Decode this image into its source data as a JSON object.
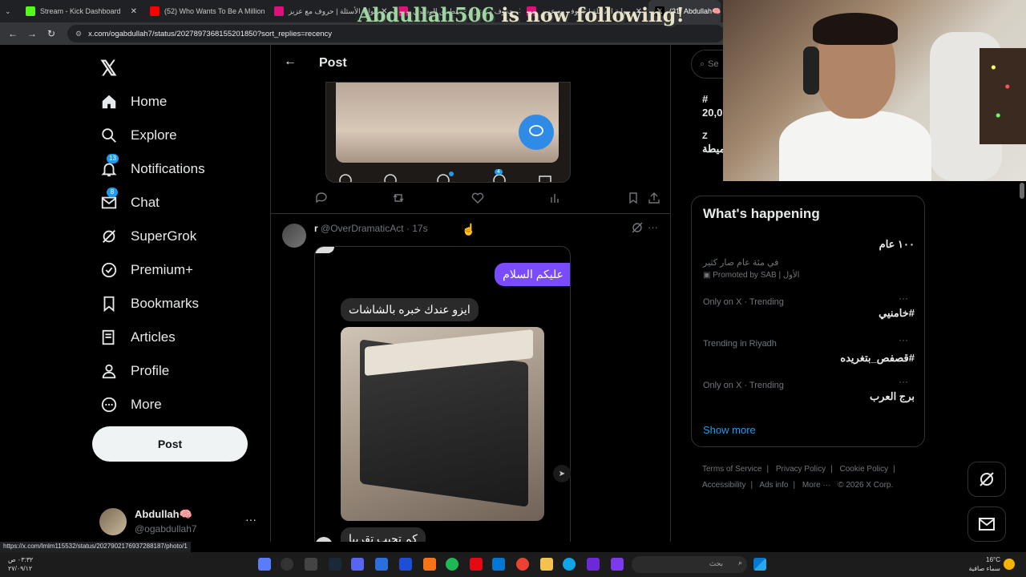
{
  "browser": {
    "tabs": [
      {
        "title": "Stream - Kick Dashboard",
        "color": "#53fc18"
      },
      {
        "title": "(52) Who Wants To Be A Million",
        "color": "#ff0000"
      },
      {
        "title": "بوابة الأسئلة | حروف مع عزيز",
        "color": "#e0107a"
      },
      {
        "title": "حروف مع عزيز - التطبيق الرسمي",
        "color": "#e0107a"
      },
      {
        "title": "بوابة الأسئلة | حروف مع عزيز",
        "color": "#e0107a"
      },
      {
        "title": "(21) Abdullah🧠",
        "color": "#ffffff"
      }
    ],
    "url": "x.com/ogabdullah7/status/2027897368155201850?sort_replies=recency",
    "status_url": "https://x.com/lmlm115532/status/2027902176937288187/photo/1"
  },
  "overlay": {
    "follow_name": "Abdullah506",
    "follow_text": " is now following!"
  },
  "nav": {
    "items": [
      {
        "label": "Home",
        "icon": "home-icon",
        "badge": ""
      },
      {
        "label": "Explore",
        "icon": "search-icon",
        "badge": ""
      },
      {
        "label": "Notifications",
        "icon": "bell-icon",
        "badge": "13"
      },
      {
        "label": "Chat",
        "icon": "mail-icon",
        "badge": "8"
      },
      {
        "label": "SuperGrok",
        "icon": "grok-icon",
        "badge": ""
      },
      {
        "label": "Premium+",
        "icon": "verified-icon",
        "badge": ""
      },
      {
        "label": "Bookmarks",
        "icon": "bookmark-icon",
        "badge": ""
      },
      {
        "label": "Articles",
        "icon": "article-icon",
        "badge": ""
      },
      {
        "label": "Profile",
        "icon": "person-icon",
        "badge": ""
      },
      {
        "label": "More",
        "icon": "more-circle-icon",
        "badge": ""
      }
    ],
    "post_button": "Post",
    "account": {
      "name": "Abdullah🧠",
      "handle": "@ogabdullah7",
      "more": "···"
    }
  },
  "main": {
    "title": "Post",
    "top_media_badges": [
      "4"
    ],
    "reply": {
      "name": "r",
      "handle": "@OverDramaticAct",
      "time": "· 17s",
      "messages": {
        "out1": "عليكم السلام",
        "in1": "ايزو عندك خبره بالشاشات",
        "in2": "كم تجيب تقريبا"
      }
    }
  },
  "right": {
    "search_placeholder": "Se",
    "peek": {
      "line1": "#",
      "line2": "20,0",
      "line3": "Z",
      "line4": "ميطة"
    },
    "happening": {
      "title": "What's happening",
      "trends": [
        {
          "headline": "١٠٠ عام",
          "desc": "في مئة عام صار كثير",
          "meta": "Promoted by SAB | الأول"
        },
        {
          "meta": "Only on X · Trending",
          "headline": "#خامنيي"
        },
        {
          "meta": "Trending in Riyadh",
          "headline": "#قصفص_بتغريده"
        },
        {
          "meta": "Only on X · Trending",
          "headline": "برج العرب"
        }
      ],
      "show_more": "Show more"
    },
    "footer": [
      "Terms of Service",
      "|",
      "Privacy Policy",
      "|",
      "Cookie Policy",
      "|",
      "Accessibility",
      "|",
      "Ads info",
      "|",
      "More ···",
      "© 2026 X Corp."
    ]
  },
  "taskbar": {
    "search_text": "بحث",
    "time": "٠٣:٣٢ ص",
    "date": "٢٧/٠٩/١٢",
    "temp": "16°C",
    "weather": "سماء صافية"
  },
  "colors": {
    "accent": "#1d9bf0",
    "chat_bubble": "#7b4bff",
    "bg": "#000000"
  }
}
